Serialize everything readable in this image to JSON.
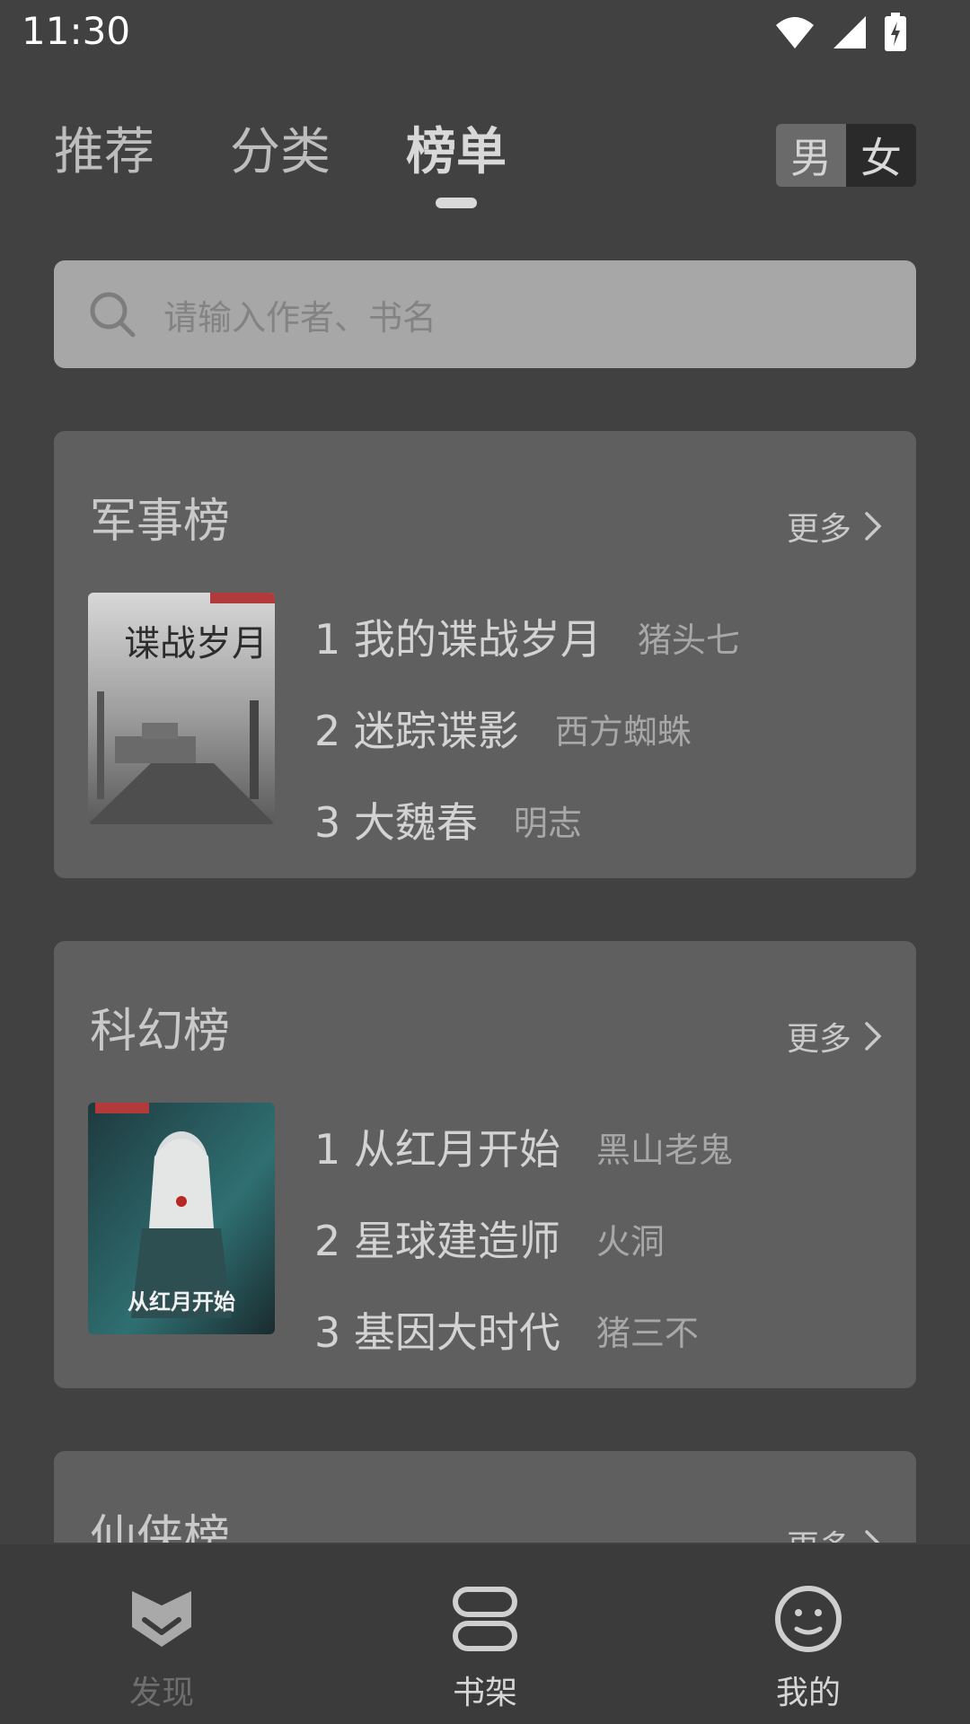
{
  "status": {
    "time": "11:30"
  },
  "tabs": [
    {
      "label": "推荐"
    },
    {
      "label": "分类"
    },
    {
      "label": "榜单"
    }
  ],
  "gender": {
    "male": "男",
    "female": "女"
  },
  "search": {
    "placeholder": "请输入作者、书名"
  },
  "cards": [
    {
      "title": "军事榜",
      "more": "更多",
      "cover_text": "谍战岁月",
      "items": [
        {
          "rank": "1",
          "title": "我的谍战岁月",
          "author": "猪头七"
        },
        {
          "rank": "2",
          "title": "迷踪谍影",
          "author": "西方蜘蛛"
        },
        {
          "rank": "3",
          "title": "大魏春",
          "author": "明志"
        }
      ]
    },
    {
      "title": "科幻榜",
      "more": "更多",
      "cover_text": "从红月开始",
      "items": [
        {
          "rank": "1",
          "title": "从红月开始",
          "author": "黑山老鬼"
        },
        {
          "rank": "2",
          "title": "星球建造师",
          "author": "火洞"
        },
        {
          "rank": "3",
          "title": "基因大时代",
          "author": "猪三不"
        }
      ]
    },
    {
      "title": "仙侠榜",
      "more": "更多"
    }
  ],
  "nav": [
    {
      "label": "发现",
      "icon": "discover-icon"
    },
    {
      "label": "书架",
      "icon": "bookshelf-icon"
    },
    {
      "label": "我的",
      "icon": "profile-icon"
    }
  ]
}
